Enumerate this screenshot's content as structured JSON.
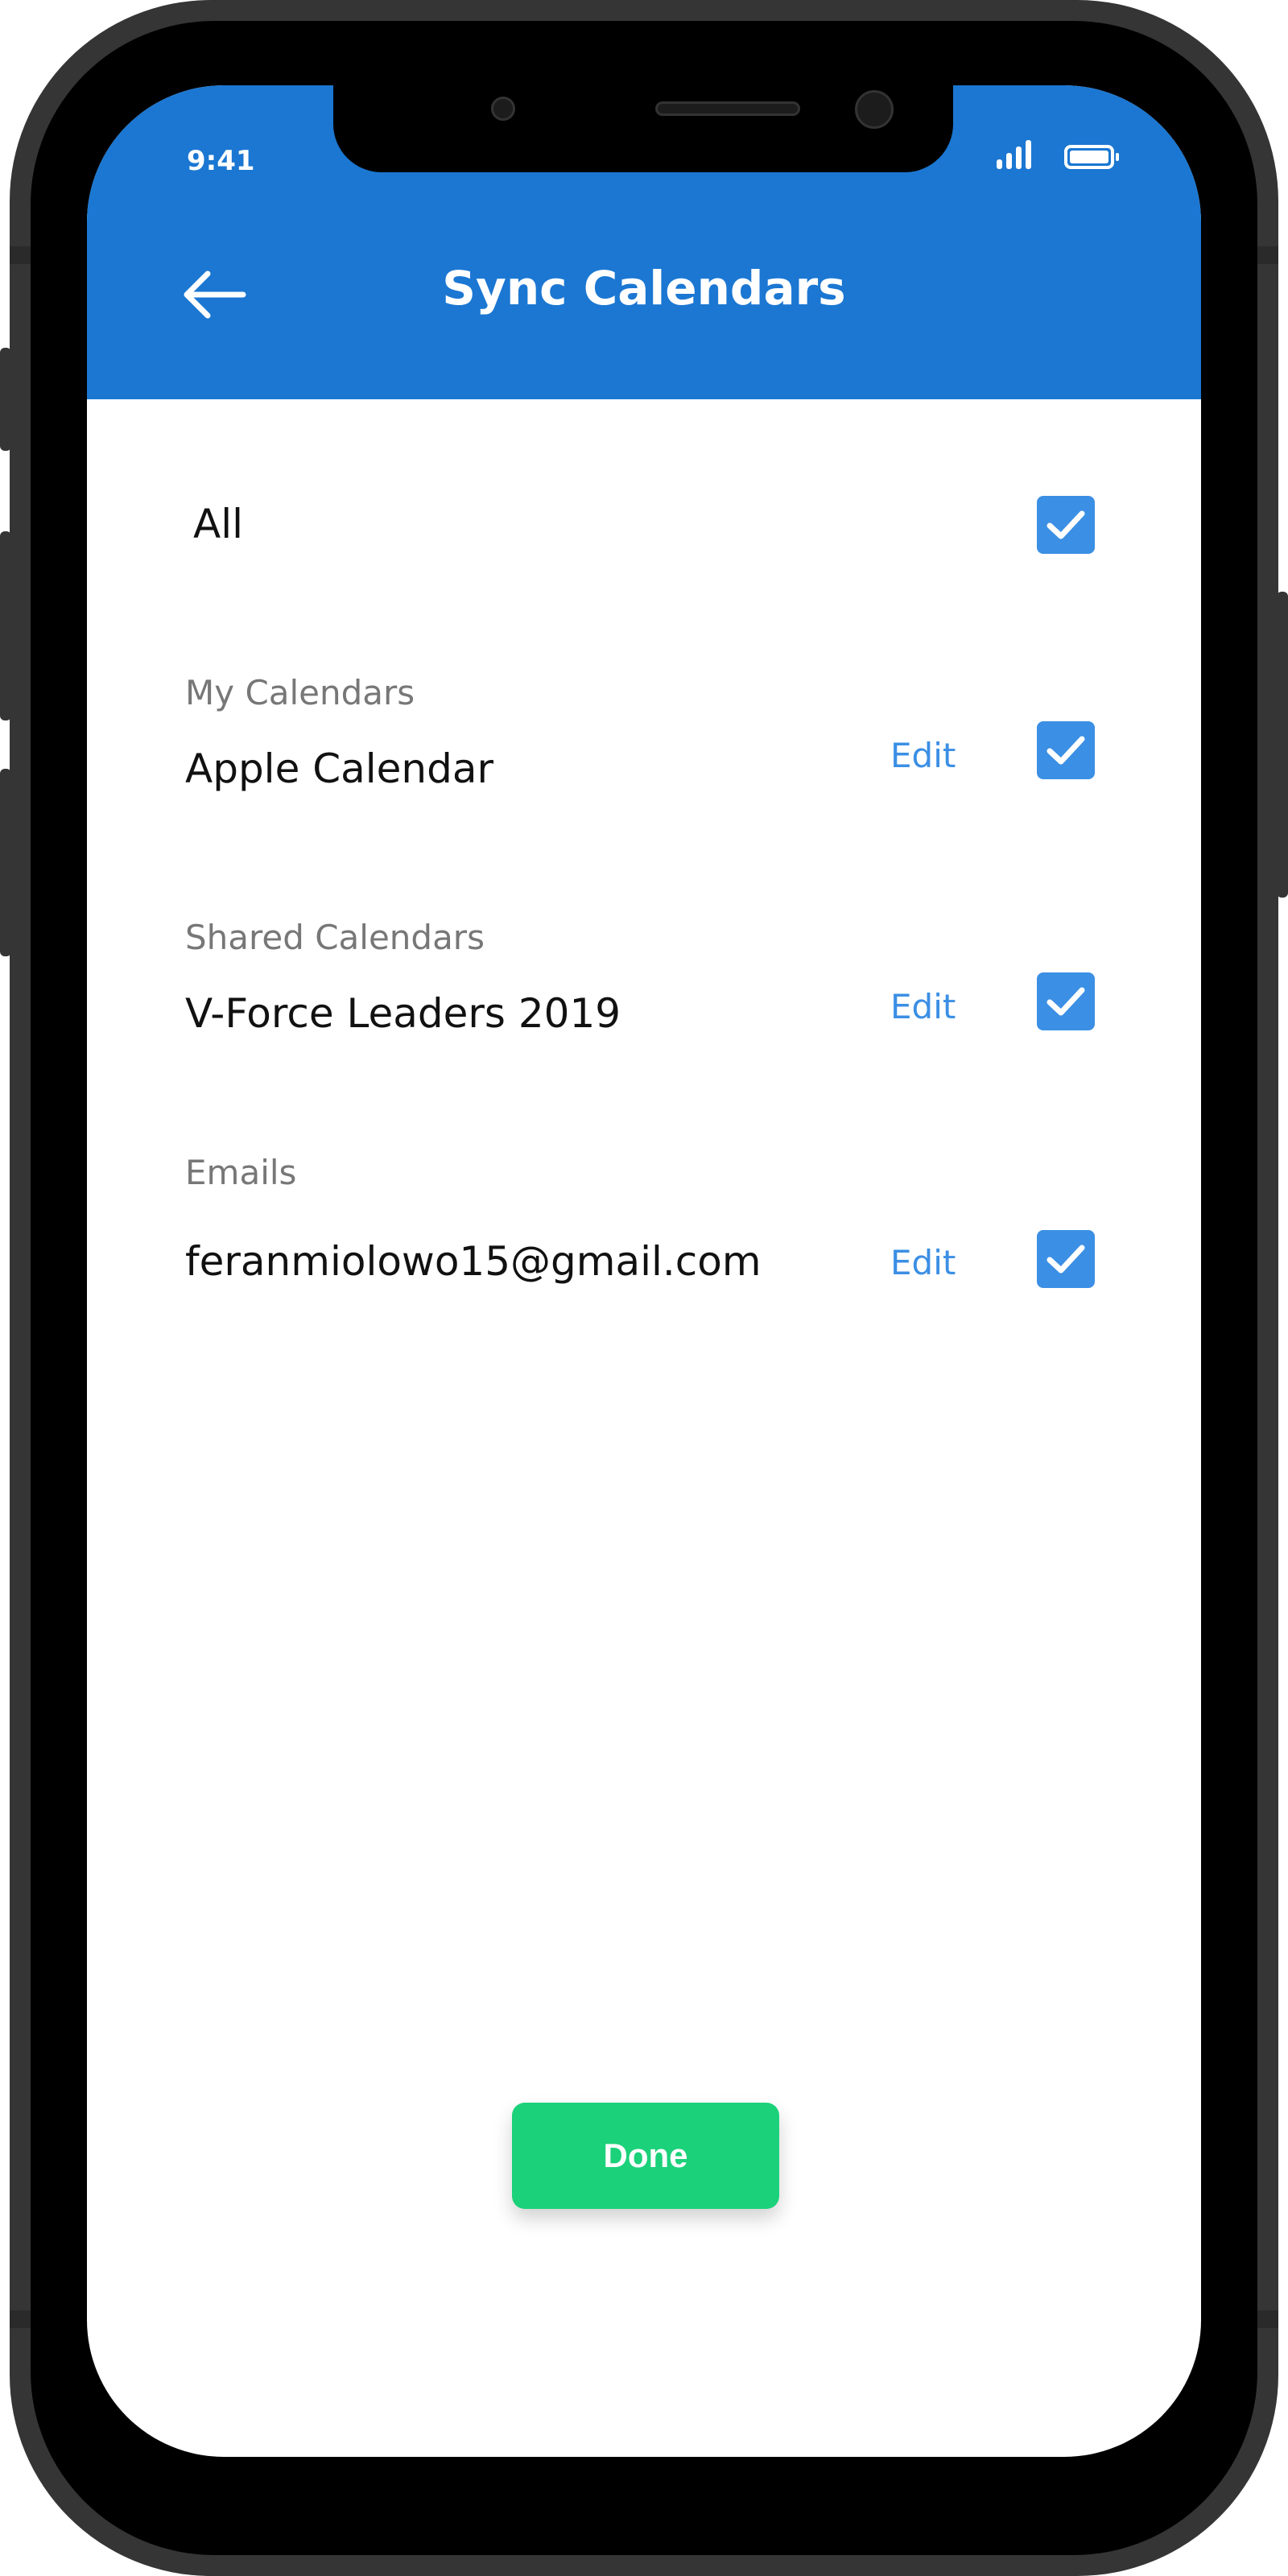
{
  "status_bar": {
    "time": "9:41",
    "signal-icon": "signal-icon",
    "battery-icon": "battery-icon"
  },
  "header": {
    "title": "Sync Calendars",
    "back_icon": "arrow-left-icon",
    "color": "#1B77D2"
  },
  "all": {
    "label": "All",
    "checked": true
  },
  "sections": [
    {
      "label": "My Calendars",
      "item": "Apple Calendar",
      "edit": "Edit",
      "checked": true
    },
    {
      "label": "Shared Calendars",
      "item": "V-Force Leaders 2019",
      "edit": "Edit",
      "checked": true
    },
    {
      "label": "Emails",
      "item": "feranmiolowo15@gmail.com",
      "edit": "Edit",
      "checked": true
    }
  ],
  "done_label": "Done",
  "colors": {
    "accent": "#3B8FE4",
    "done": "#1BD17A"
  }
}
